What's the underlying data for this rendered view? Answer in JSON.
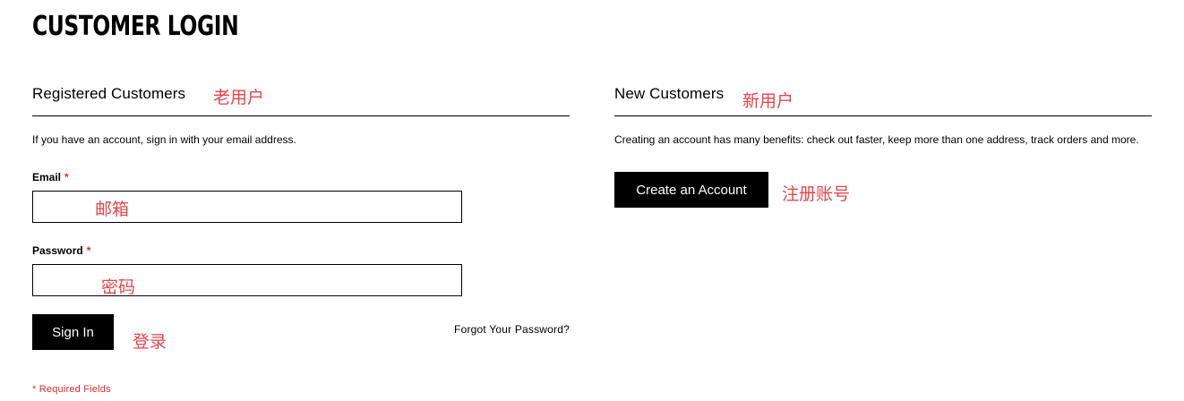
{
  "page": {
    "title": "Customer Login"
  },
  "registered": {
    "heading": "Registered Customers",
    "intro": "If you have an account, sign in with your email address.",
    "email": {
      "label": "Email",
      "required_mark": "*",
      "value": ""
    },
    "password": {
      "label": "Password",
      "required_mark": "*",
      "value": ""
    },
    "sign_in_label": "Sign In",
    "forgot_label": "Forgot Your Password?",
    "required_note": "* Required Fields"
  },
  "new_customers": {
    "heading": "New Customers",
    "intro": "Creating an account has many benefits: check out faster, keep more than one address, track orders and more.",
    "create_label": "Create an Account"
  },
  "annotations": {
    "registered": "老用户",
    "email": "邮箱",
    "password": "密码",
    "sign_in": "登录",
    "new_customers": "新用户",
    "create_account": "注册账号"
  },
  "colors": {
    "button_bg": "#000000",
    "button_text": "#ffffff",
    "required": "#e02b27",
    "annotation": "#e8444a"
  }
}
